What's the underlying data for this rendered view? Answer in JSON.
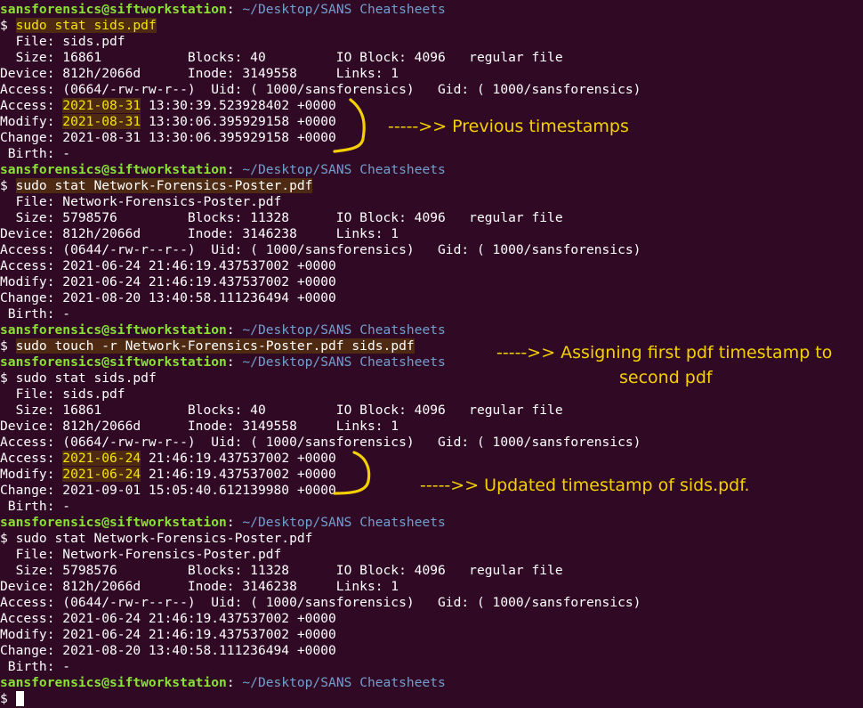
{
  "prompt": {
    "user": "sansforensics@siftworkstation",
    "sep": ":",
    "path": " ~/Desktop/SANS Cheatsheets",
    "dollar": "$ "
  },
  "blocks": [
    {
      "command": "sudo stat sids.pdf",
      "file": "  File: sids.pdf",
      "size": "  Size: 16861           Blocks: 40         IO Block: 4096   regular file",
      "device": "Device: 812h/2066d      Inode: 3149558     Links: 1",
      "perms": "Access: (0664/-rw-rw-r--)  Uid: ( 1000/sansforensics)   Gid: ( 1000/sansforensics)",
      "access": {
        "date": "2021-08-31",
        "time": " 13:30:39.523928402 +0000"
      },
      "modify": {
        "date": "2021-08-31",
        "time": " 13:30:06.395929158 +0000"
      },
      "change": "Change: 2021-08-31 13:30:06.395929158 +0000",
      "birth": " Birth: -"
    },
    {
      "command": "sudo stat Network-Forensics-Poster.pdf",
      "file": "  File: Network-Forensics-Poster.pdf",
      "size": "  Size: 5798576         Blocks: 11328      IO Block: 4096   regular file",
      "device": "Device: 812h/2066d      Inode: 3146238     Links: 1",
      "perms": "Access: (0644/-rw-r--r--)  Uid: ( 1000/sansforensics)   Gid: ( 1000/sansforensics)",
      "access": "Access: 2021-06-24 21:46:19.437537002 +0000",
      "modify": "Modify: 2021-06-24 21:46:19.437537002 +0000",
      "change": "Change: 2021-08-20 13:40:58.111236494 +0000",
      "birth": " Birth: -"
    },
    {
      "command": "sudo touch -r Network-Forensics-Poster.pdf sids.pdf"
    },
    {
      "command": "sudo stat sids.pdf",
      "file": "  File: sids.pdf",
      "size": "  Size: 16861           Blocks: 40         IO Block: 4096   regular file",
      "device": "Device: 812h/2066d      Inode: 3149558     Links: 1",
      "perms": "Access: (0664/-rw-rw-r--)  Uid: ( 1000/sansforensics)   Gid: ( 1000/sansforensics)",
      "access": {
        "date": "2021-06-24",
        "time": " 21:46:19.437537002 +0000"
      },
      "modify": {
        "date": "2021-06-24",
        "time": " 21:46:19.437537002 +0000"
      },
      "change": "Change: 2021-09-01 15:05:40.612139980 +0000",
      "birth": " Birth: -"
    },
    {
      "command": "sudo stat Network-Forensics-Poster.pdf",
      "file": "  File: Network-Forensics-Poster.pdf",
      "size": "  Size: 5798576         Blocks: 11328      IO Block: 4096   regular file",
      "device": "Device: 812h/2066d      Inode: 3146238     Links: 1",
      "perms": "Access: (0644/-rw-r--r--)  Uid: ( 1000/sansforensics)   Gid: ( 1000/sansforensics)",
      "access": "Access: 2021-06-24 21:46:19.437537002 +0000",
      "modify": "Modify: 2021-06-24 21:46:19.437537002 +0000",
      "change": "Change: 2021-08-20 13:40:58.111236494 +0000",
      "birth": " Birth: -"
    }
  ],
  "labels": {
    "access": "Access: ",
    "modify": "Modify: "
  },
  "annotations": {
    "previous": "----->> Previous timestamps",
    "assign_line1": "----->> Assigning first pdf timestamp to",
    "assign_line2": "second pdf",
    "updated": "----->> Updated timestamp of sids.pdf."
  },
  "colors": {
    "background": "#300a24",
    "prompt_user": "#8ae234",
    "prompt_path": "#729fcf",
    "annotation": "#f5d000",
    "highlight_bg": "#4f2a13"
  }
}
